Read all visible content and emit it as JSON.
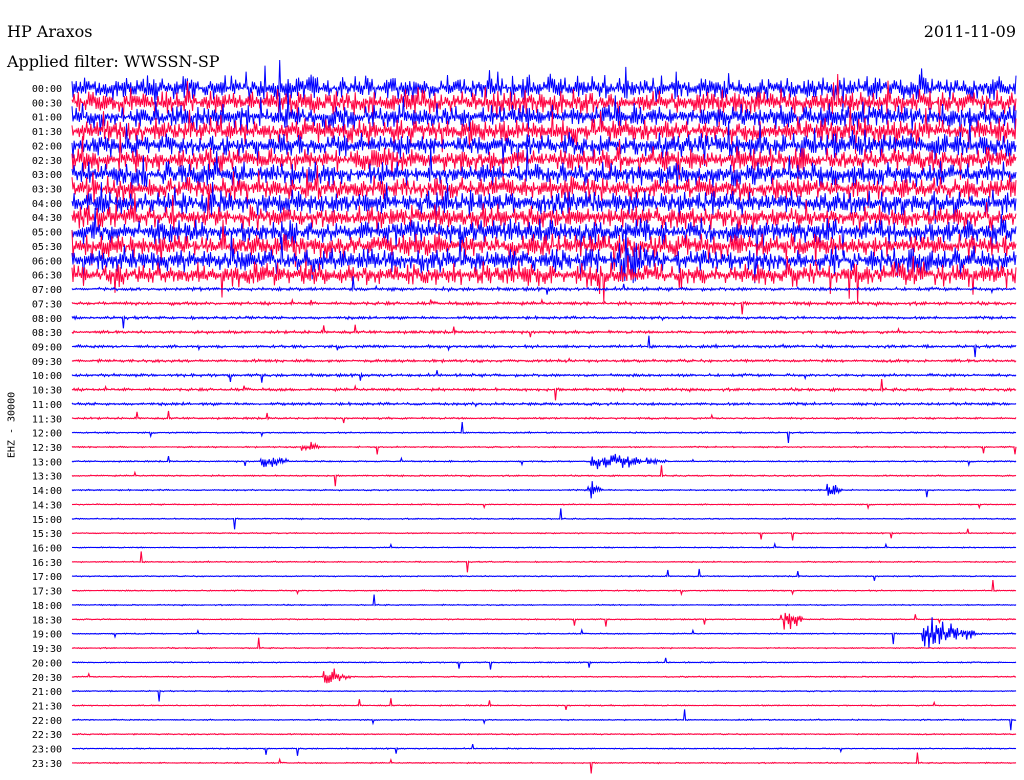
{
  "header": {
    "station": "HP Araxos",
    "date": "2011-11-09",
    "filter_prefix": "Applied filter:",
    "filter_value": "WWSSN-SP"
  },
  "channel_label": "EHZ - 30000",
  "colors": {
    "trace_a": "#0000ff",
    "trace_b": "#ff0040"
  },
  "chart_data": {
    "type": "line",
    "title": "HP Araxos",
    "subtitle": "Applied filter: WWSSN-SP",
    "ylabel": "EHZ - 30000",
    "xlabel": "",
    "rows": [
      "00:00",
      "00:30",
      "01:00",
      "01:30",
      "02:00",
      "02:30",
      "03:00",
      "03:30",
      "04:00",
      "04:30",
      "05:00",
      "05:30",
      "06:00",
      "06:30",
      "07:00",
      "07:30",
      "08:00",
      "08:30",
      "09:00",
      "09:30",
      "10:00",
      "10:30",
      "11:00",
      "11:30",
      "12:00",
      "12:30",
      "13:00",
      "13:30",
      "14:00",
      "14:30",
      "15:00",
      "15:30",
      "16:00",
      "16:30",
      "17:00",
      "17:30",
      "18:00",
      "18:30",
      "19:00",
      "19:30",
      "20:00",
      "20:30",
      "21:00",
      "21:30",
      "22:00",
      "22:30",
      "23:00",
      "23:30"
    ],
    "row_duration_minutes": 30,
    "row_colors_alternate": [
      "blue",
      "red"
    ],
    "noise_level": [
      1,
      1,
      1,
      1,
      1,
      1,
      1,
      1,
      1,
      1,
      1,
      1,
      1,
      1,
      0.14,
      0.14,
      0.12,
      0.12,
      0.12,
      0.12,
      0.12,
      0.12,
      0.12,
      0.08,
      0.06,
      0.06,
      0.06,
      0.06,
      0.06,
      0.05,
      0.05,
      0.05,
      0.05,
      0.05,
      0.05,
      0.05,
      0.05,
      0.05,
      0.05,
      0.05,
      0.05,
      0.05,
      0.05,
      0.05,
      0.05,
      0.05,
      0.05,
      0.05
    ],
    "events": [
      {
        "row": 12,
        "minute": 17.4,
        "amp": 22,
        "dur": 1.2
      },
      {
        "row": 25,
        "minute": 7.3,
        "amp": 10,
        "dur": 0.6
      },
      {
        "row": 26,
        "minute": 6.0,
        "amp": 8,
        "dur": 1.0
      },
      {
        "row": 26,
        "minute": 16.5,
        "amp": 9,
        "dur": 2.5
      },
      {
        "row": 28,
        "minute": 16.4,
        "amp": 10,
        "dur": 0.5
      },
      {
        "row": 28,
        "minute": 24.0,
        "amp": 9,
        "dur": 0.5
      },
      {
        "row": 38,
        "minute": 27.0,
        "amp": 16,
        "dur": 2.0
      },
      {
        "row": 37,
        "minute": 22.6,
        "amp": 12,
        "dur": 0.7
      },
      {
        "row": 41,
        "minute": 8.0,
        "amp": 9,
        "dur": 0.9
      }
    ]
  }
}
